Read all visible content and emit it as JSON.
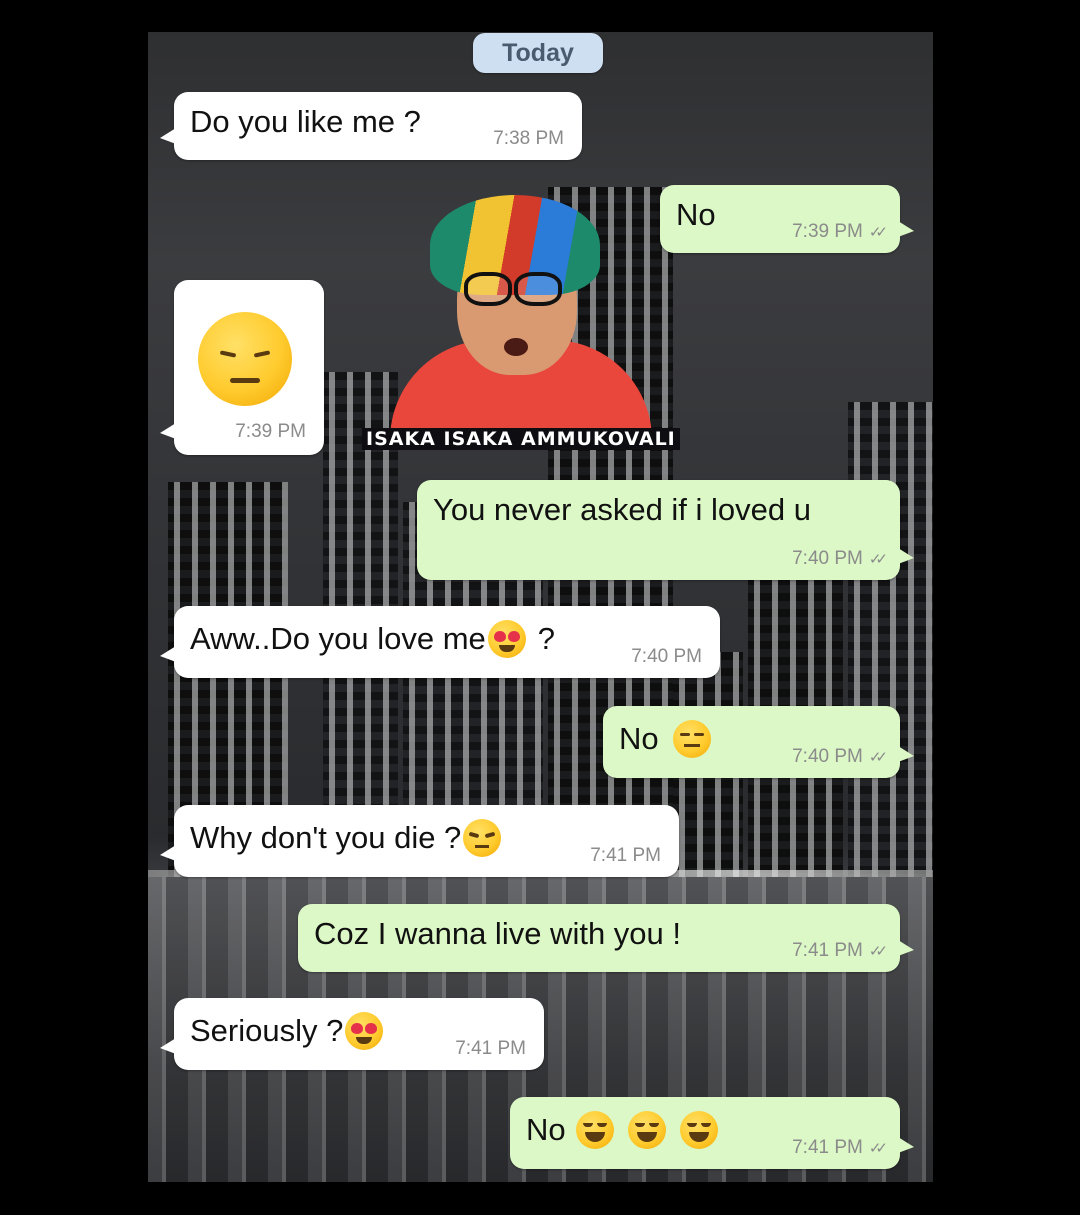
{
  "chat": {
    "date_label": "Today",
    "messages": [
      {
        "dir": "in",
        "text": "Do you like me ?",
        "time": "7:38 PM"
      },
      {
        "dir": "out",
        "text": "No",
        "time": "7:39 PM"
      },
      {
        "dir": "in",
        "text": "",
        "emoji": "pensive-face",
        "time": "7:39 PM"
      },
      {
        "dir": "out",
        "text": "You never asked if i loved u",
        "time": "7:40 PM"
      },
      {
        "dir": "in",
        "text": "Aww..Do you love me",
        "suffix": "?",
        "emoji": "heart-eyes-face",
        "time": "7:40 PM"
      },
      {
        "dir": "out",
        "text": "No",
        "emoji": "expressionless-face",
        "time": "7:40 PM"
      },
      {
        "dir": "in",
        "text": "Why don't you die ?",
        "emoji": "unamused-face",
        "time": "7:41 PM"
      },
      {
        "dir": "out",
        "text": "Coz I wanna live with you !",
        "time": "7:41 PM"
      },
      {
        "dir": "in",
        "text": "Seriously ?",
        "emoji": "heart-eyes-face",
        "time": "7:41 PM"
      },
      {
        "dir": "out",
        "text": "No",
        "emoji": "tears-of-joy-face x3",
        "time": "7:41 PM"
      }
    ],
    "read_receipt": "✓✓"
  },
  "sticker": {
    "caption": "ISAKA ISAKA AMMUKOVALI"
  },
  "colors": {
    "incoming_bubble": "#ffffff",
    "outgoing_bubble": "#dcf8c6",
    "date_chip": "#cfdff2",
    "timestamp": "#8b8b8b"
  }
}
